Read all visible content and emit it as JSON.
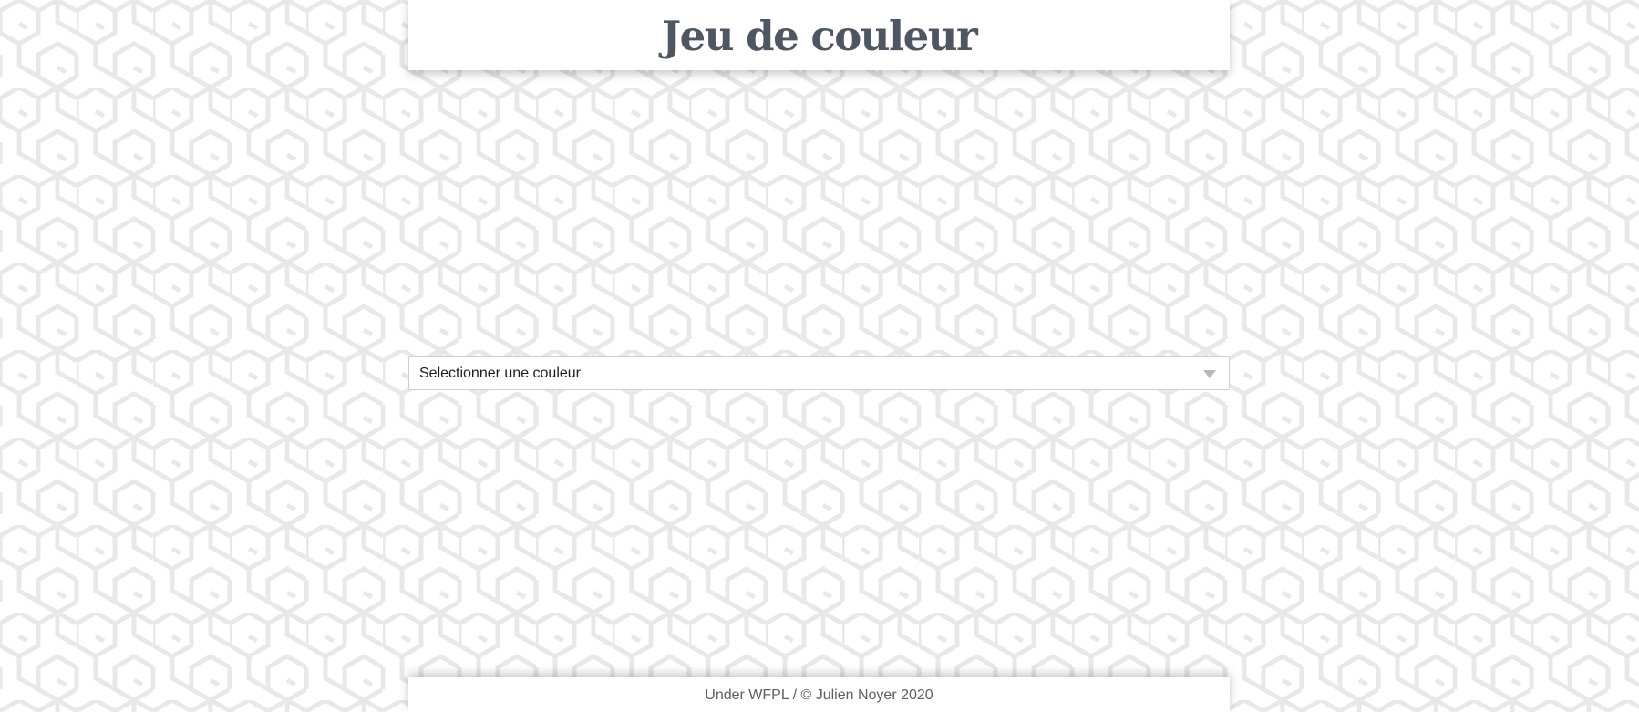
{
  "page": {
    "title": "Jeu de couleur"
  },
  "color_select": {
    "selected_label": "Selectionner une couleur",
    "arrow_icon": "triangle-down-icon"
  },
  "footer": {
    "text": "Under WFPL / © Julien Noyer 2020"
  },
  "colors": {
    "title_text": "#4e5661",
    "background": "#ffffff",
    "pattern_stroke": "#e8e8e8",
    "select_border": "#cfcfcf",
    "footer_text": "#5a5f66"
  }
}
